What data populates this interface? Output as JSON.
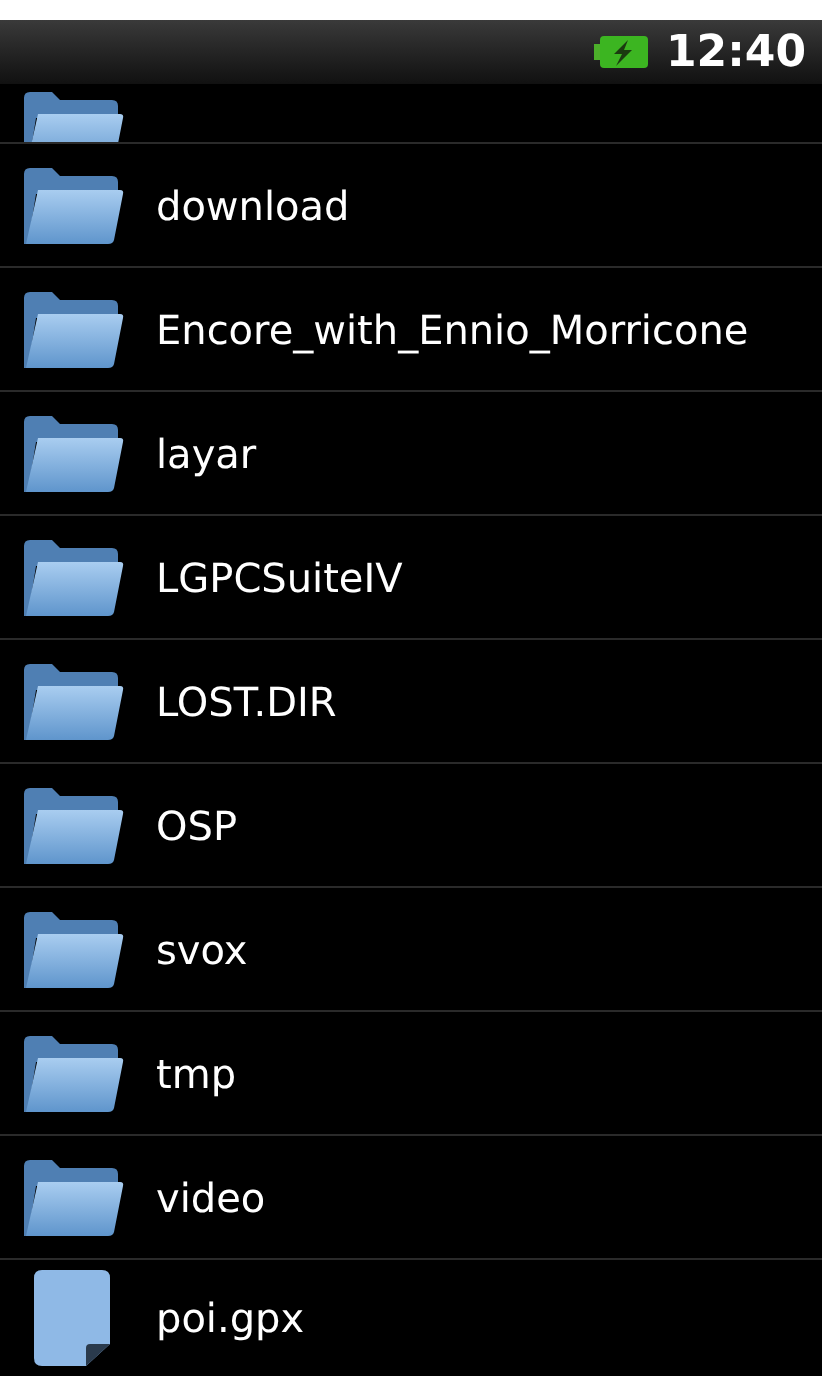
{
  "status_bar": {
    "time": "12:40",
    "battery_charging": true
  },
  "items": [
    {
      "kind": "folder",
      "name": "download"
    },
    {
      "kind": "folder",
      "name": "Encore_with_Ennio_Morricone"
    },
    {
      "kind": "folder",
      "name": "layar"
    },
    {
      "kind": "folder",
      "name": "LGPCSuiteIV"
    },
    {
      "kind": "folder",
      "name": "LOST.DIR"
    },
    {
      "kind": "folder",
      "name": "OSP"
    },
    {
      "kind": "folder",
      "name": "svox"
    },
    {
      "kind": "folder",
      "name": "tmp"
    },
    {
      "kind": "folder",
      "name": "video"
    },
    {
      "kind": "file",
      "name": "poi.gpx"
    }
  ]
}
